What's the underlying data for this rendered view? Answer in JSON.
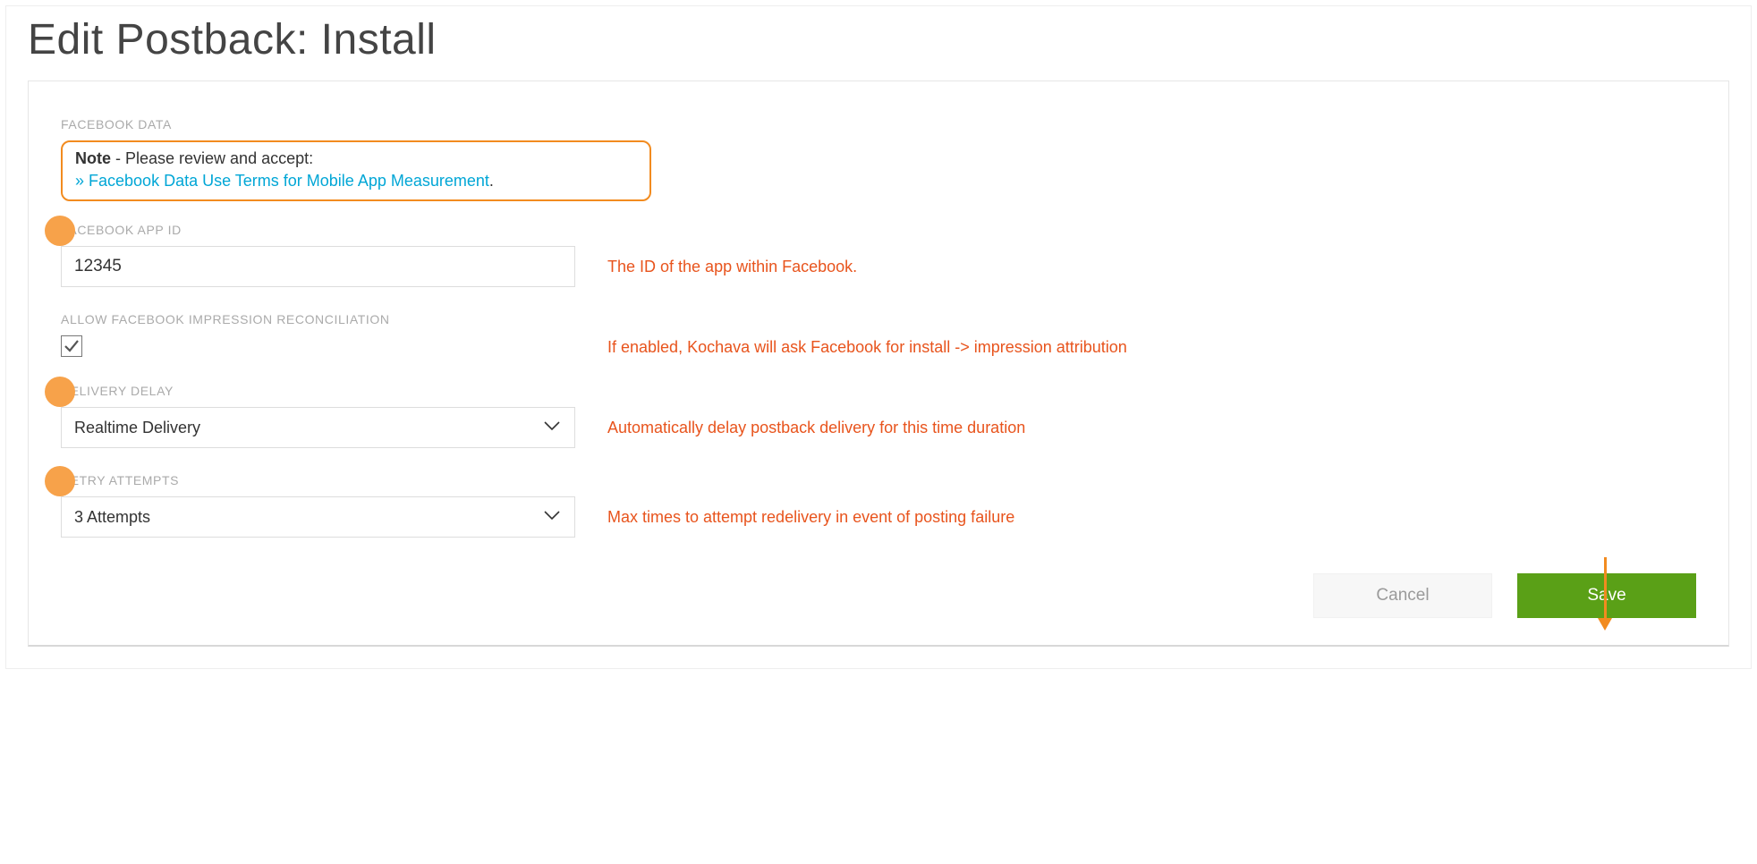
{
  "page": {
    "title": "Edit Postback: Install"
  },
  "facebook_data": {
    "label": "FACEBOOK DATA",
    "note_bold": "Note",
    "note_rest": " - Please review and accept:",
    "arrows": "» ",
    "link_text": "Facebook Data Use Terms for Mobile App Measurement",
    "period": "."
  },
  "app_id": {
    "label": "FACEBOOK APP ID",
    "value": "12345",
    "helper": "The ID of the app within Facebook."
  },
  "impression": {
    "label": "ALLOW FACEBOOK IMPRESSION RECONCILIATION",
    "checked": true,
    "helper": "If enabled, Kochava will ask Facebook for install -> impression attribution"
  },
  "delivery_delay": {
    "label": "DELIVERY DELAY",
    "value": "Realtime Delivery",
    "helper": "Automatically delay postback delivery for this time duration"
  },
  "retry": {
    "label": "RETRY ATTEMPTS",
    "value": "3 Attempts",
    "helper": "Max times to attempt redelivery in event of posting failure"
  },
  "actions": {
    "cancel": "Cancel",
    "save": "Save"
  }
}
